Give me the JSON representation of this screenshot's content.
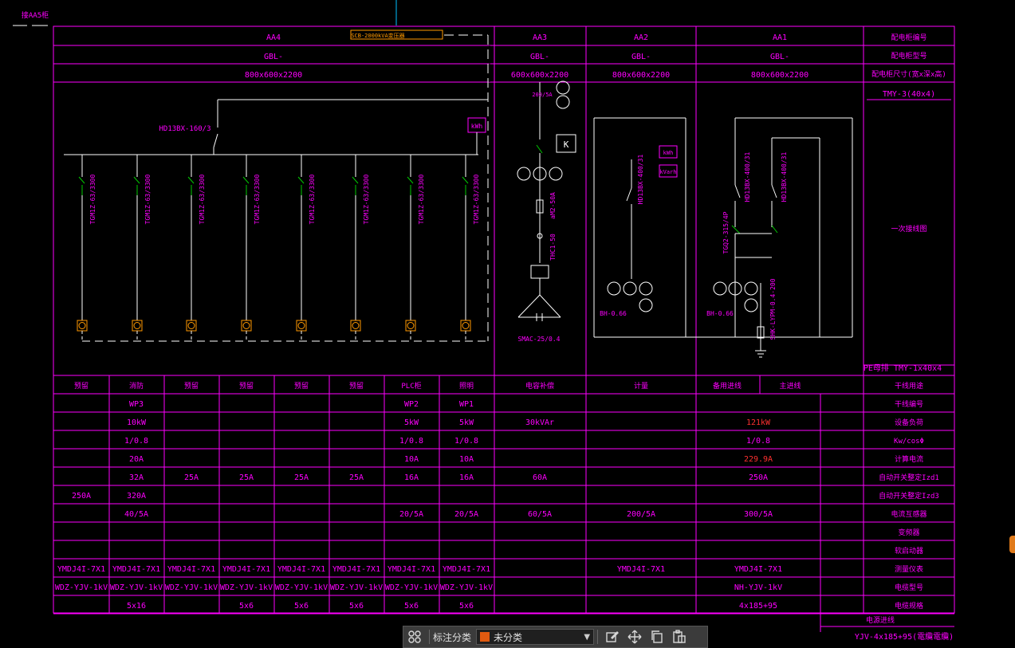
{
  "drawing": {
    "top_left_label": "接AA5柜",
    "title_tag": "SCB-2000kVA变压器",
    "colors": {
      "grid": "#ff00ff",
      "text": "#ff00ff",
      "white": "#ffffff",
      "green": "#00c800",
      "red": "#ff3030",
      "orange": "#ff9900",
      "cyan": "#00bfff"
    },
    "cabinets": [
      {
        "id": "AA4",
        "model": "GBL-",
        "size": "800x600x2200"
      },
      {
        "id": "AA3",
        "model": "GBL-",
        "size": "600x600x2200"
      },
      {
        "id": "AA2",
        "model": "GBL-",
        "size": "800x600x2200"
      },
      {
        "id": "AA1",
        "model": "GBL-",
        "size": "800x600x2200"
      }
    ],
    "right_header": [
      "配电柜编号",
      "配电柜型号",
      "配电柜尺寸(宽x深x高)"
    ],
    "busbar_label": "TMY-3(40x4)",
    "one_line_label": "一次接线图",
    "pe_label": "PE母排 TMY-1x40x4",
    "aa4": {
      "main_switch": "HD13BX-160/3",
      "meter": "kWh",
      "breakers": [
        "TGM1Z-63/3300",
        "TGM1Z-63/3300",
        "TGM1Z-63/3300",
        "TGM1Z-63/3300",
        "TGM1Z-63/3300",
        "TGM1Z-63/3300",
        "TGM1Z-63/3300",
        "TGM1Z-63/3300"
      ]
    },
    "aa3": {
      "ct": "200/5A",
      "contactor": "K",
      "fuse": "aM2-50A",
      "thermal": "THC1-50",
      "capacitor": "SMAC-25/0.4"
    },
    "aa2": {
      "switch": "HD13BX-400/31",
      "meters": [
        "kWh",
        "kVarh"
      ],
      "ct": "BH-0.66"
    },
    "aa1": {
      "switch_a": "HD13BX-400/31",
      "switch_b": "HD13BX-400/31",
      "ats": "TGQ2-315/4P",
      "ct": "BH-0.66",
      "arrester": "SHK-LYPM-0.4-200"
    },
    "table": {
      "row_labels": [
        "干线用途",
        "干线编号",
        "设备负荷",
        "Kw/cosΦ",
        "计算电流",
        "自动开关整定Izd1",
        "自动开关整定Izd3",
        "电流互感器",
        "变频器",
        "软启动器",
        "测量仪表",
        "电缆型号",
        "电缆规格"
      ],
      "purpose": [
        "预留",
        "消防",
        "预留",
        "预留",
        "预留",
        "预留",
        "PLC柜",
        "照明",
        "电容补偿",
        "计量",
        "备用进线",
        "主进线"
      ],
      "rows": [
        [
          "",
          "WP3",
          "",
          "",
          "",
          "",
          "WP2",
          "WP1",
          "",
          "",
          ""
        ],
        [
          "",
          "10kW",
          "",
          "",
          "",
          "",
          "5kW",
          "5kW",
          "30kVAr",
          "",
          "121kW"
        ],
        [
          "",
          "1/0.8",
          "",
          "",
          "",
          "",
          "1/0.8",
          "1/0.8",
          "",
          "",
          "1/0.8"
        ],
        [
          "",
          "20A",
          "",
          "",
          "",
          "",
          "10A",
          "10A",
          "",
          "",
          "229.9A"
        ],
        [
          "",
          "32A",
          "25A",
          "25A",
          "25A",
          "25A",
          "16A",
          "16A",
          "60A",
          "",
          "250A"
        ],
        [
          "250A",
          "320A",
          "",
          "",
          "",
          "",
          "",
          "",
          "",
          "",
          ""
        ],
        [
          "",
          "40/5A",
          "",
          "",
          "",
          "",
          "20/5A",
          "20/5A",
          "60/5A",
          "200/5A",
          "300/5A"
        ],
        [
          "",
          "",
          "",
          "",
          "",
          "",
          "",
          "",
          "",
          "",
          ""
        ],
        [
          "",
          "",
          "",
          "",
          "",
          "",
          "",
          "",
          "",
          "",
          ""
        ],
        [
          "YMDJ4I-7X1",
          "YMDJ4I-7X1",
          "YMDJ4I-7X1",
          "YMDJ4I-7X1",
          "YMDJ4I-7X1",
          "YMDJ4I-7X1",
          "YMDJ4I-7X1",
          "YMDJ4I-7X1",
          "",
          "YMDJ4I-7X1",
          "YMDJ4I-7X1"
        ],
        [
          "WDZ-YJV-1kV",
          "WDZ-YJV-1kV",
          "WDZ-YJV-1kV",
          "WDZ-YJV-1kV",
          "WDZ-YJV-1kV",
          "WDZ-YJV-1kV",
          "WDZ-YJV-1kV",
          "WDZ-YJV-1kV",
          "",
          "",
          "NH-YJV-1kV"
        ],
        [
          "",
          "5x16",
          "",
          "5x6",
          "5x6",
          "5x6",
          "5x6",
          "5x6",
          "",
          "",
          "4x185+95"
        ]
      ],
      "red_cells": [
        "1-10",
        "3-10"
      ]
    },
    "incoming_cable_label": "电源进线",
    "incoming_cable": "YJV-4x185+95(電纜電纜)"
  },
  "toolbar": {
    "category_label": "标注分类",
    "category_value": "未分类",
    "icons": [
      "grid-icon",
      "edit-icon",
      "move-icon",
      "copy-icon",
      "paste-icon"
    ]
  }
}
